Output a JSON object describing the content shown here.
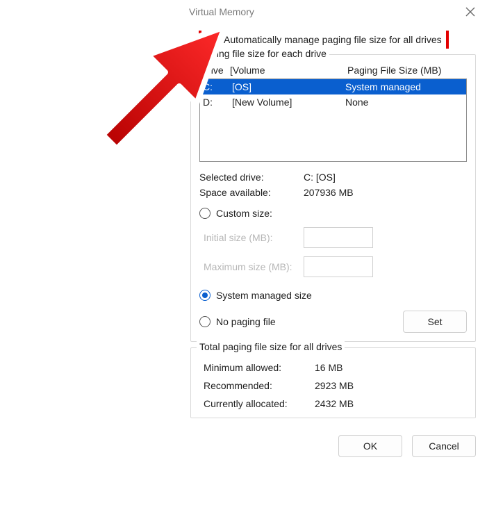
{
  "title": "Virtual Memory",
  "auto_manage_label": "Automatically manage paging file size for all drives",
  "auto_manage_checked": false,
  "group1": {
    "legend": "Paging file size for each drive",
    "col_drive": "Drive",
    "col_volume": "[Volume",
    "col_size": "Paging File Size (MB)",
    "drives": [
      {
        "letter": "C:",
        "volume": "[OS]",
        "size": "System managed",
        "selected": true
      },
      {
        "letter": "D:",
        "volume": "[New Volume]",
        "size": "None",
        "selected": false
      }
    ],
    "selected_drive_label": "Selected drive:",
    "selected_drive_value": "C:  [OS]",
    "space_label": "Space available:",
    "space_value": "207936 MB",
    "custom_label": "Custom size:",
    "initial_label": "Initial size (MB):",
    "maximum_label": "Maximum size (MB):",
    "system_managed_label": "System managed size",
    "no_paging_label": "No paging file",
    "set_button": "Set",
    "selected_mode": "system"
  },
  "totals": {
    "legend": "Total paging file size for all drives",
    "min_label": "Minimum allowed:",
    "min_value": "16 MB",
    "rec_label": "Recommended:",
    "rec_value": "2923 MB",
    "cur_label": "Currently allocated:",
    "cur_value": "2432 MB"
  },
  "ok_label": "OK",
  "cancel_label": "Cancel"
}
